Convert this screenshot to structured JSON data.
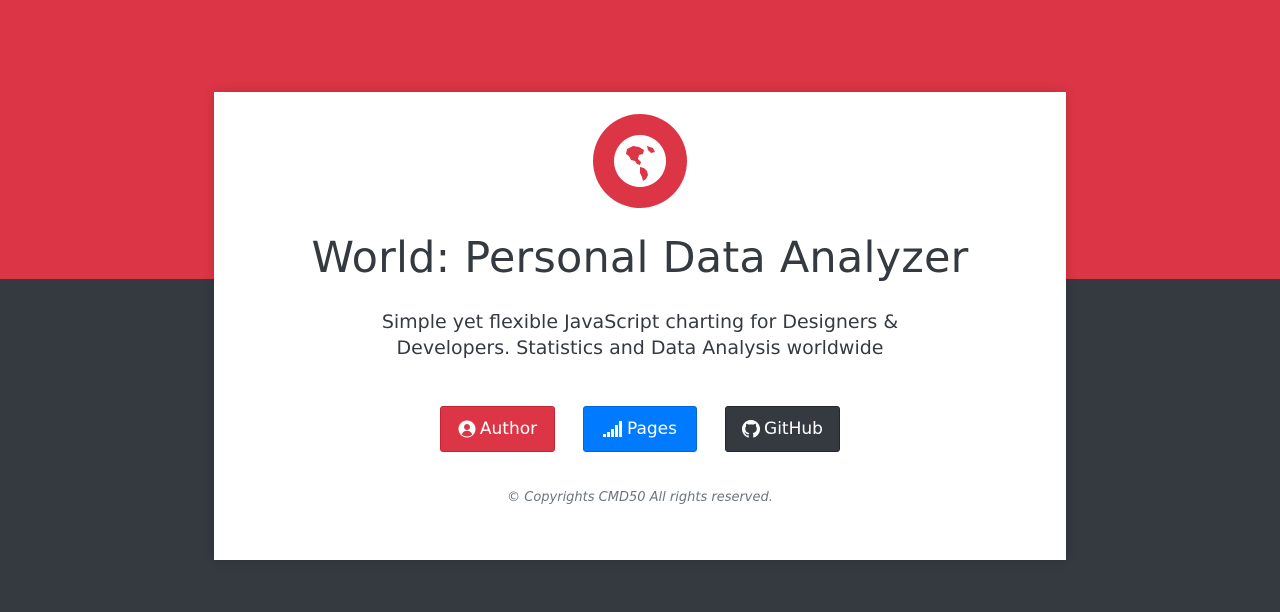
{
  "hero": {
    "title": "World: Personal Data Analyzer",
    "subtitle": "Simple yet flexible JavaScript charting for Designers & Developers. Statistics and Data Analysis worldwide",
    "logo_icon": "globe-americas-icon"
  },
  "buttons": {
    "author": {
      "label": "Author",
      "icon": "user-circle-icon"
    },
    "pages": {
      "label": "Pages",
      "icon": "signal-bars-icon"
    },
    "github": {
      "label": "GitHub",
      "icon": "github-icon"
    }
  },
  "footer": {
    "copyright": "© Copyrights CMD50 All rights reserved."
  },
  "colors": {
    "primary_red": "#dc3545",
    "dark": "#343a40",
    "blue": "#007bff",
    "card": "#ffffff"
  }
}
